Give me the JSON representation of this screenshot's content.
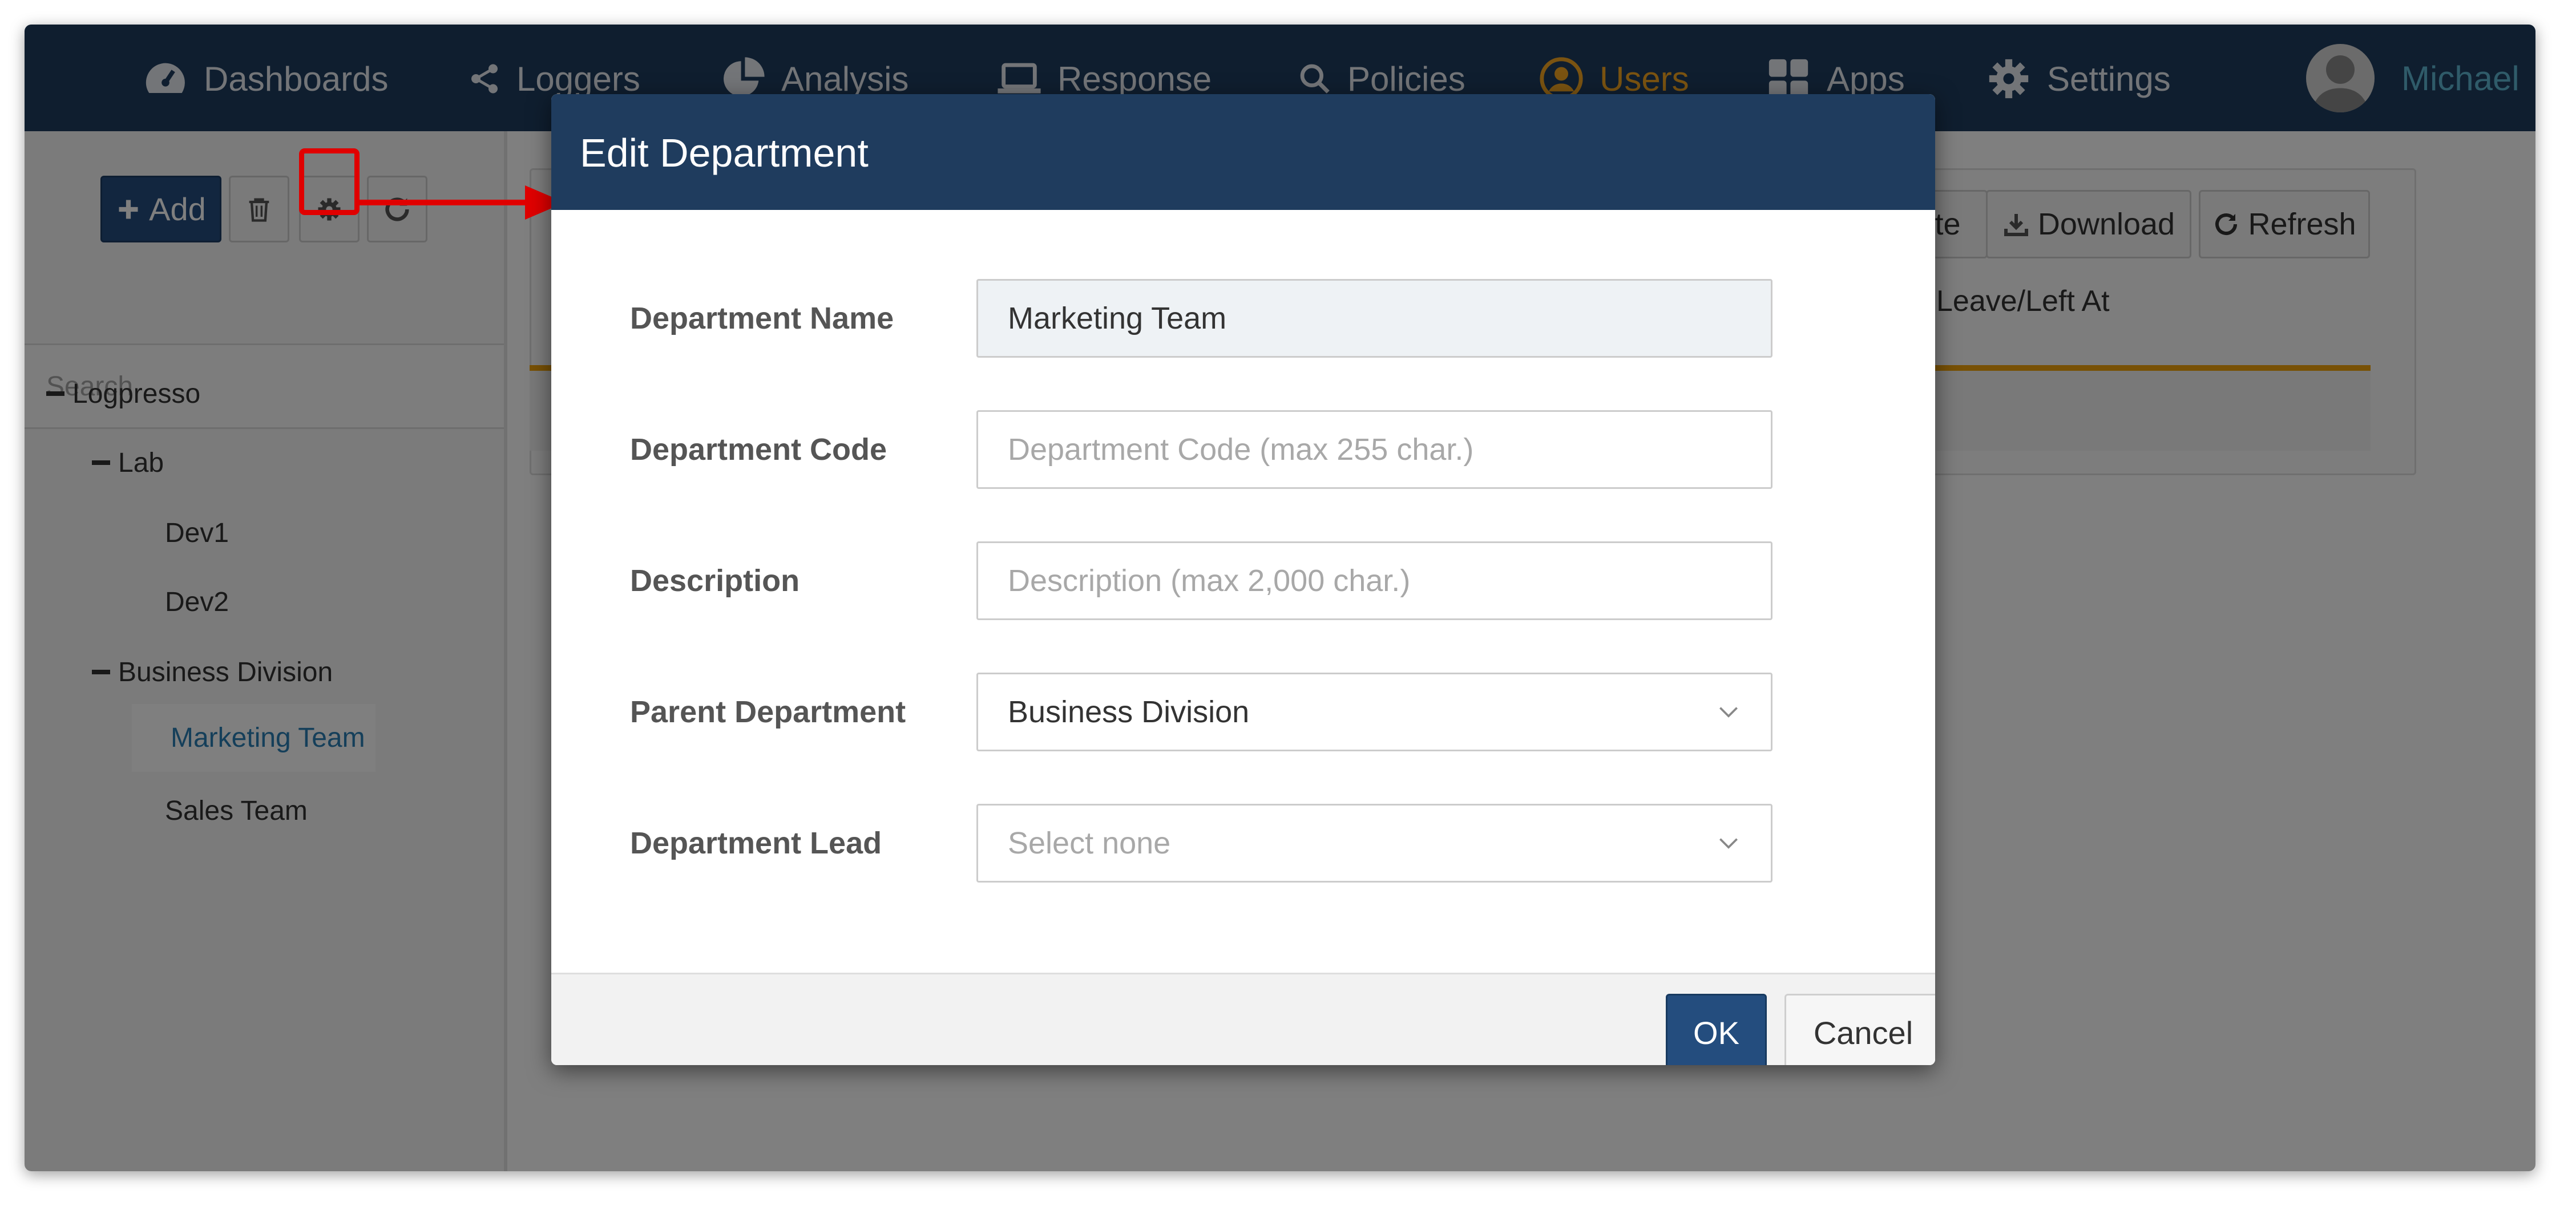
{
  "nav": {
    "items": [
      {
        "label": "Dashboards",
        "icon": "dashboard-gauge-icon"
      },
      {
        "label": "Loggers",
        "icon": "share-nodes-icon"
      },
      {
        "label": "Analysis",
        "icon": "pie-chart-icon"
      },
      {
        "label": "Response",
        "icon": "laptop-icon"
      },
      {
        "label": "Policies",
        "icon": "search-icon"
      },
      {
        "label": "Users",
        "icon": "user-circle-icon",
        "active": true
      },
      {
        "label": "Apps",
        "icon": "grid-icon"
      },
      {
        "label": "Settings",
        "icon": "gear-icon"
      }
    ],
    "user_name": "Michael"
  },
  "sidebar": {
    "add_label": "Add",
    "search_placeholder": "Search",
    "tree": [
      {
        "label": "Logpresso",
        "level": 0,
        "expanded": true
      },
      {
        "label": "Lab",
        "level": 1,
        "expanded": true
      },
      {
        "label": "Dev1",
        "level": 2
      },
      {
        "label": "Dev2",
        "level": 2
      },
      {
        "label": "Business Division",
        "level": 1,
        "expanded": true
      },
      {
        "label": "Marketing Team",
        "level": 2,
        "selected": true
      },
      {
        "label": "Sales Team",
        "level": 2
      }
    ]
  },
  "content": {
    "partial_button_label": "te",
    "download_label": "Download",
    "refresh_label": "Refresh",
    "column_header": "Leave/Left At"
  },
  "modal": {
    "title": "Edit Department",
    "fields": {
      "name": {
        "label": "Department Name",
        "value": "Marketing Team"
      },
      "code": {
        "label": "Department Code",
        "placeholder": "Department Code (max 255 char.)"
      },
      "description": {
        "label": "Description",
        "placeholder": "Description (max 2,000 char.)"
      },
      "parent": {
        "label": "Parent Department",
        "value": "Business Division"
      },
      "lead": {
        "label": "Department Lead",
        "placeholder": "Select none"
      }
    },
    "ok_label": "OK",
    "cancel_label": "Cancel"
  },
  "colors": {
    "nav_background": "#1f3c5e",
    "active_nav": "#f5a623",
    "primary_button": "#244d7e",
    "annotation_red": "#e00000",
    "selected_tree_text": "#2b7fb4"
  }
}
